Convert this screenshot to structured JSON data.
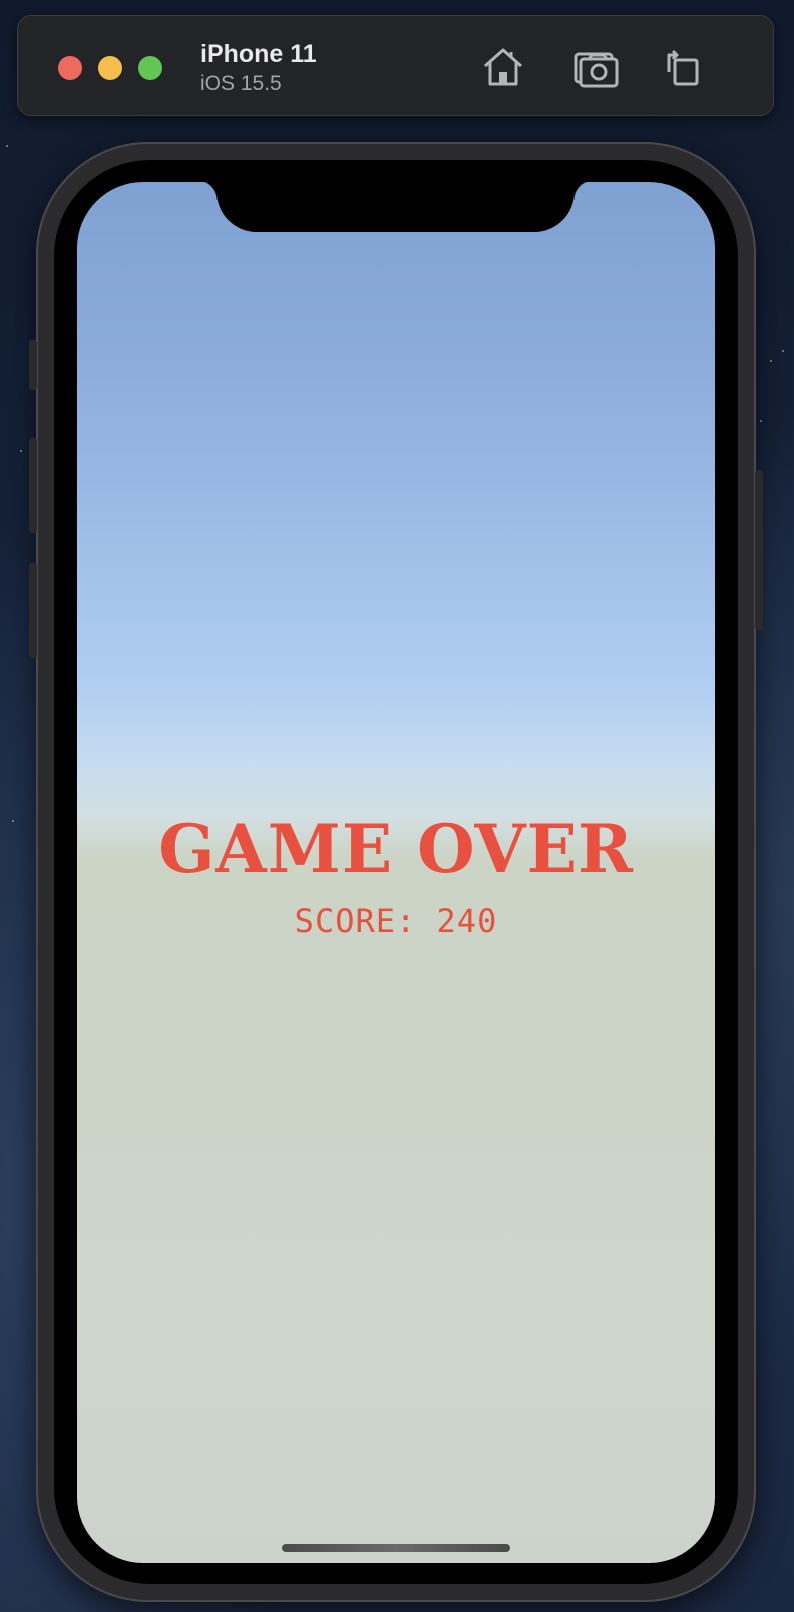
{
  "simulator": {
    "device_name": "iPhone 11",
    "os_version": "iOS 15.5",
    "toolbar_icons": [
      "home-icon",
      "screenshot-icon",
      "rotate-icon"
    ]
  },
  "game": {
    "title": "GAME OVER",
    "score_text": "SCORE: 240",
    "text_color": "#e8513f"
  }
}
